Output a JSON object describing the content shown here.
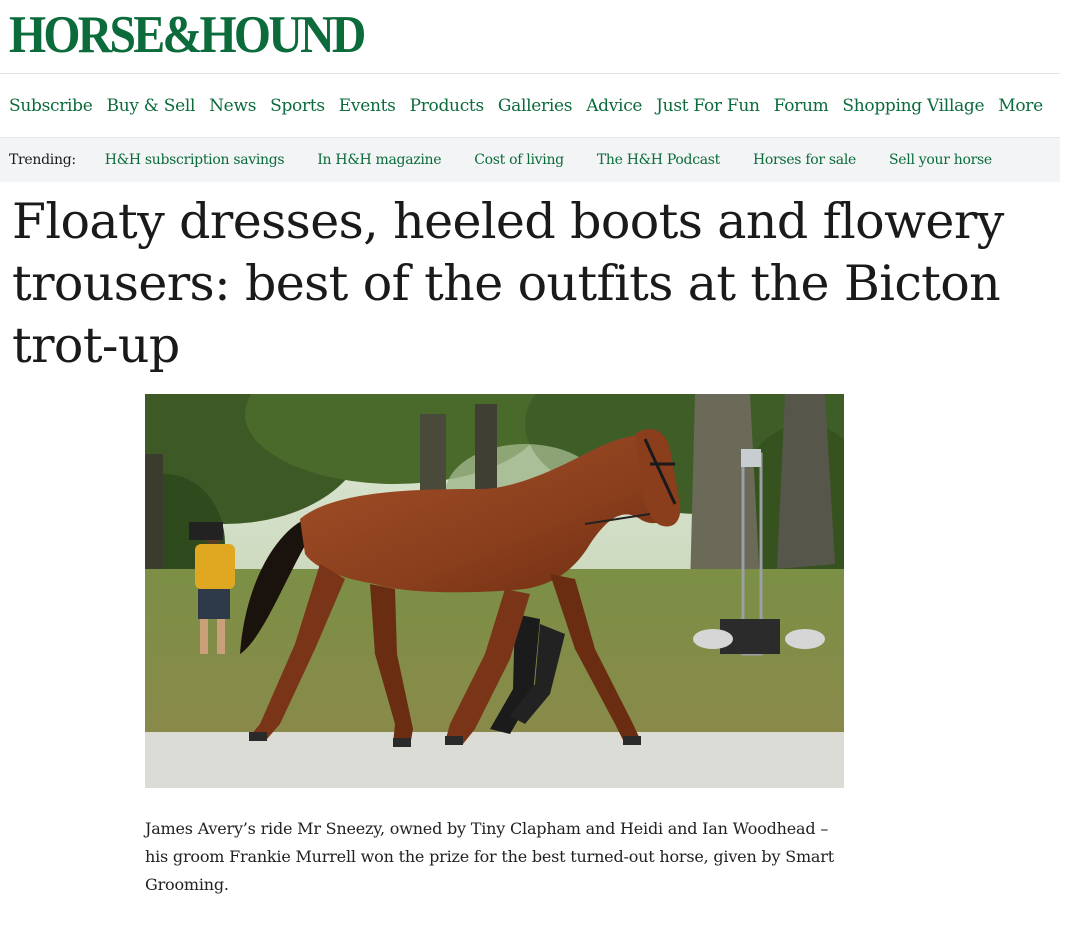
{
  "site": {
    "logo_text": "HORSE&HOUND",
    "brand_color": "#0b6b3a"
  },
  "nav": {
    "items": [
      {
        "label": "Subscribe"
      },
      {
        "label": "Buy & Sell"
      },
      {
        "label": "News"
      },
      {
        "label": "Sports"
      },
      {
        "label": "Events"
      },
      {
        "label": "Products"
      },
      {
        "label": "Galleries"
      },
      {
        "label": "Advice"
      },
      {
        "label": "Just For Fun"
      },
      {
        "label": "Forum"
      },
      {
        "label": "Shopping Village"
      },
      {
        "label": "More"
      }
    ]
  },
  "trending": {
    "label": "Trending:",
    "items": [
      {
        "label": "H&H subscription savings"
      },
      {
        "label": "In H&H magazine"
      },
      {
        "label": "Cost of living"
      },
      {
        "label": "The H&H Podcast"
      },
      {
        "label": "Horses for sale"
      },
      {
        "label": "Sell your horse"
      }
    ]
  },
  "article": {
    "headline": "Floaty dresses, heeled boots and flowery trousers: best of the outfits at the Bicton trot-up",
    "caption": "James Avery’s ride Mr Sneezy, owned by Tiny Clapham and Heidi and Ian Woodhead – his groom Frankie Murrell won the prize for the best turned-out horse, given by Smart Grooming."
  }
}
